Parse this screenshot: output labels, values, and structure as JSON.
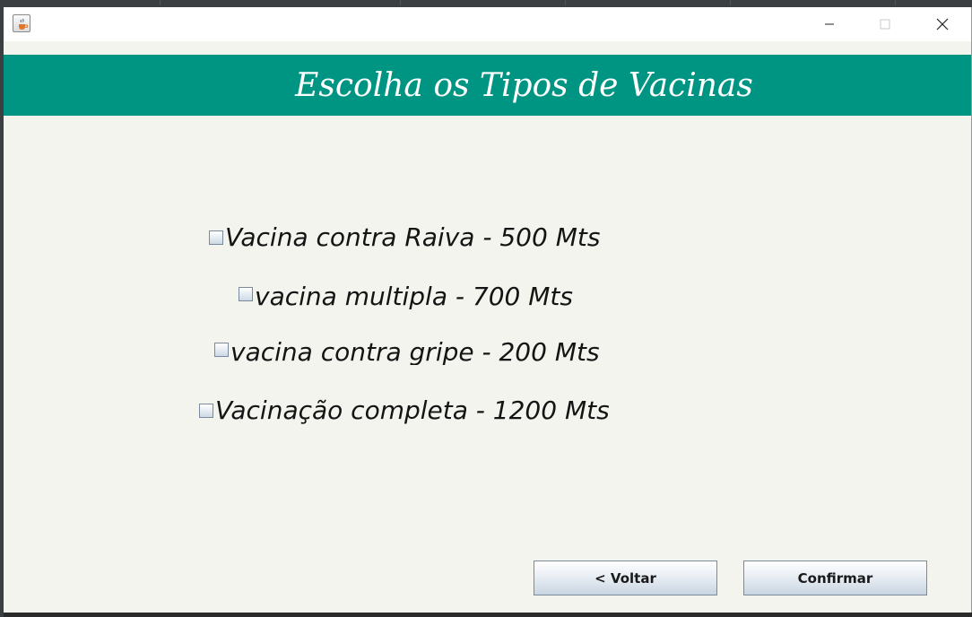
{
  "window": {
    "title_controls": {
      "minimize": "—",
      "maximize": "□",
      "close": "✕"
    },
    "icon": "java-cup-icon"
  },
  "header": {
    "title": "Escolha os Tipos de Vacinas",
    "background_color": "#009482"
  },
  "options": [
    {
      "label": "Vacina contra Raiva - 500 Mts",
      "checked": false
    },
    {
      "label": "vacina multipla - 700 Mts",
      "checked": false
    },
    {
      "label": "vacina contra gripe - 200 Mts",
      "checked": false
    },
    {
      "label": "Vacinação completa - 1200 Mts",
      "checked": false
    }
  ],
  "buttons": {
    "back_label": "< Voltar",
    "confirm_label": "Confirmar"
  }
}
